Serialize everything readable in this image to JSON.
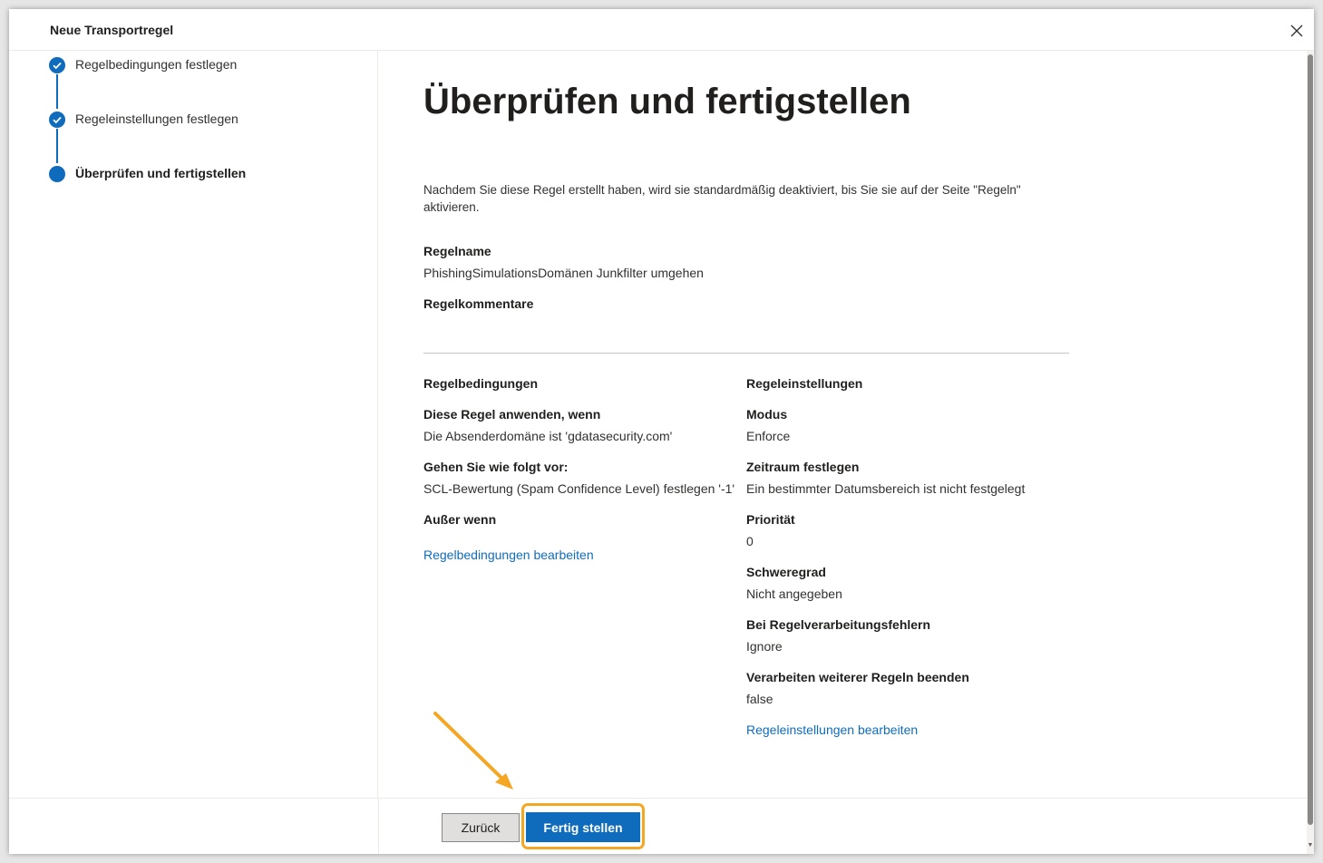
{
  "panel": {
    "title": "Neue Transportregel"
  },
  "steps": [
    {
      "label": "Regelbedingungen festlegen"
    },
    {
      "label": "Regeleinstellungen festlegen"
    },
    {
      "label": "Überprüfen und fertigstellen"
    }
  ],
  "main": {
    "title": "Überprüfen und fertigstellen",
    "intro": "Nachdem Sie diese Regel erstellt haben, wird sie standardmäßig deaktiviert, bis Sie sie auf der Seite \"Regeln\" aktivieren.",
    "rule_name_label": "Regelname",
    "rule_name_value": "PhishingSimulationsDomänen Junkfilter umgehen",
    "rule_comments_label": "Regelkommentare"
  },
  "conditions": {
    "heading": "Regelbedingungen",
    "apply_label": "Diese Regel anwenden, wenn",
    "apply_value": "Die Absenderdomäne ist 'gdatasecurity.com'",
    "action_label": "Gehen Sie wie folgt vor:",
    "action_value": "SCL-Bewertung (Spam Confidence Level) festlegen '-1'",
    "except_label": "Außer wenn",
    "edit_link": "Regelbedingungen bearbeiten"
  },
  "settings": {
    "heading": "Regeleinstellungen",
    "mode_label": "Modus",
    "mode_value": "Enforce",
    "period_label": "Zeitraum festlegen",
    "period_value": "Ein bestimmter Datumsbereich ist nicht festgelegt",
    "priority_label": "Priorität",
    "priority_value": "0",
    "severity_label": "Schweregrad",
    "severity_value": "Nicht angegeben",
    "errors_label": "Bei Regelverarbeitungsfehlern",
    "errors_value": "Ignore",
    "stop_label": "Verarbeiten weiterer Regeln beenden",
    "stop_value": "false",
    "edit_link": "Regeleinstellungen bearbeiten"
  },
  "footer": {
    "back_label": "Zurück",
    "finish_label": "Fertig stellen"
  },
  "colors": {
    "accent": "#0f6cbd",
    "highlight": "#f5a623"
  }
}
